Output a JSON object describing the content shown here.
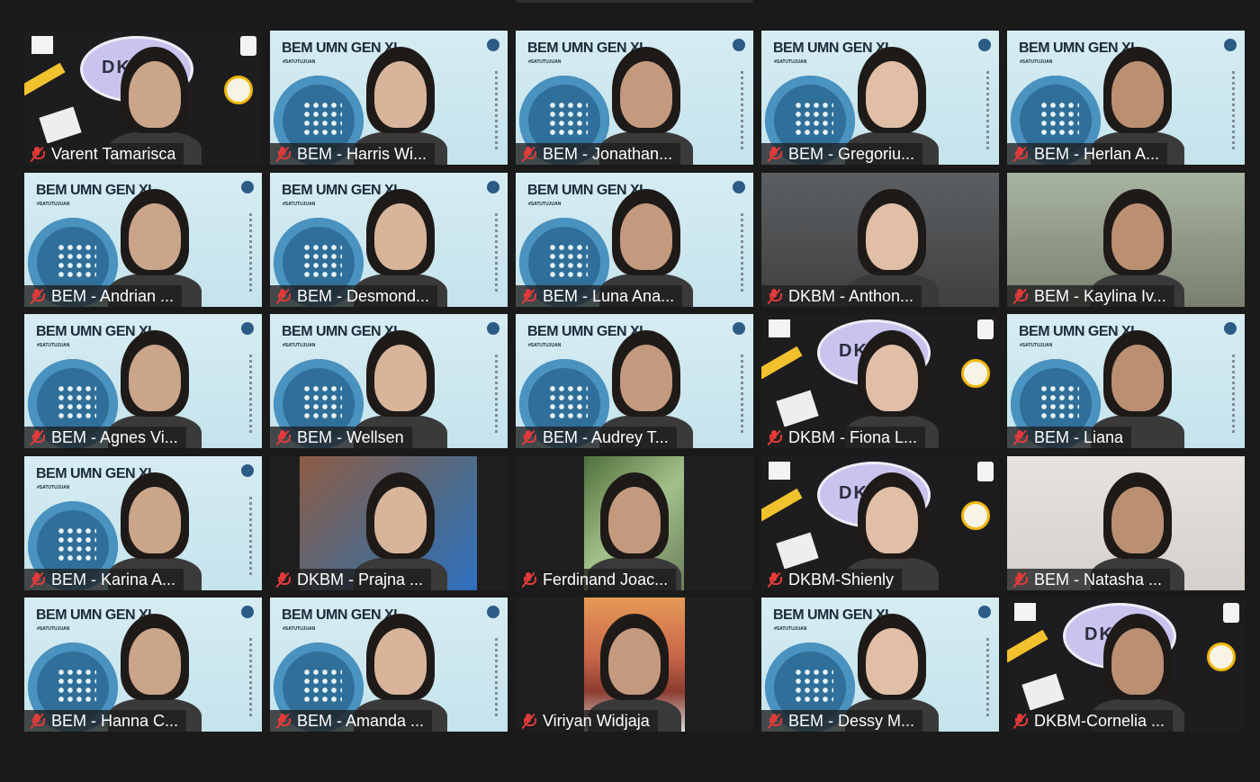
{
  "meeting": {
    "view": "gallery",
    "participants": [
      {
        "name": "Varent Tamarisca",
        "background": "dkbm",
        "muted": true
      },
      {
        "name": "BEM - Harris Wi...",
        "background": "bem",
        "muted": true
      },
      {
        "name": "BEM - Jonathan...",
        "background": "bem",
        "muted": true
      },
      {
        "name": "BEM - Gregoriu...",
        "background": "bem",
        "muted": true
      },
      {
        "name": "BEM - Herlan A...",
        "background": "bem",
        "muted": true
      },
      {
        "name": "BEM - Andrian ...",
        "background": "bem",
        "muted": true
      },
      {
        "name": "BEM - Desmond...",
        "background": "bem",
        "muted": true
      },
      {
        "name": "BEM - Luna Ana...",
        "background": "bem",
        "muted": true
      },
      {
        "name": "DKBM - Anthon...",
        "background": "room-gray",
        "muted": true
      },
      {
        "name": "BEM - Kaylina Iv...",
        "background": "room-green",
        "muted": true
      },
      {
        "name": "BEM - Agnes Vi...",
        "background": "bem",
        "muted": true
      },
      {
        "name": "BEM - Wellsen",
        "background": "bem",
        "muted": true
      },
      {
        "name": "BEM - Audrey T...",
        "background": "bem",
        "muted": true
      },
      {
        "name": "DKBM - Fiona L...",
        "background": "dkbm",
        "muted": true
      },
      {
        "name": "BEM - Liana",
        "background": "bem",
        "muted": true
      },
      {
        "name": "BEM - Karina A...",
        "background": "bem",
        "muted": true
      },
      {
        "name": "DKBM - Prajna ...",
        "background": "brick",
        "muted": true
      },
      {
        "name": "Ferdinand Joac...",
        "background": "plants",
        "muted": true
      },
      {
        "name": "DKBM-Shienly",
        "background": "dkbm",
        "muted": true
      },
      {
        "name": "BEM - Natasha ...",
        "background": "room-white",
        "muted": true
      },
      {
        "name": "BEM - Hanna C...",
        "background": "bem",
        "muted": true
      },
      {
        "name": "BEM - Amanda ...",
        "background": "bem",
        "muted": true
      },
      {
        "name": "Viriyan Widjaja",
        "background": "bridge",
        "muted": true
      },
      {
        "name": "BEM - Dessy M...",
        "background": "bem",
        "muted": true
      },
      {
        "name": "DKBM-Cornelia ...",
        "background": "dkbm",
        "muted": true
      }
    ]
  },
  "backgrounds": {
    "bem_title": "BEM UMN GEN XI",
    "bem_subtitle": "#SATUTUJUAN",
    "dkbm_title": "DKBM"
  },
  "colors": {
    "page": "#1a1a1a",
    "label_bg": "#1e1e1e",
    "muted_icon": "#e23a3a",
    "bem_bg": "#d6ecf2"
  }
}
